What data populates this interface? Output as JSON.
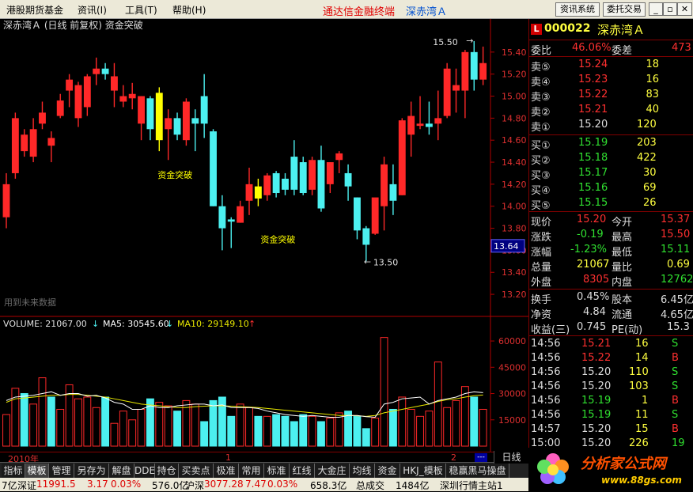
{
  "menu": {
    "items": [
      "港股期货基金",
      "资讯(I)",
      "工具(T)",
      "帮助(H)"
    ],
    "promo": "通达信金融终端",
    "stock_title": "深赤湾Ａ",
    "btn_news": "资讯系统",
    "btn_trade": "委托交易"
  },
  "chart": {
    "header": "深赤湾Ａ (日线 前复权) 资金突破",
    "ylim": [
      13.1,
      15.6
    ],
    "yticks": [
      "15.40",
      "15.20",
      "15.00",
      "14.80",
      "14.60",
      "14.40",
      "14.20",
      "14.00",
      "13.80",
      "13.60",
      "13.40",
      "13.20"
    ],
    "ytick_values": [
      15.4,
      15.2,
      15.0,
      14.8,
      14.6,
      14.4,
      14.2,
      14.0,
      13.8,
      13.6,
      13.4,
      13.2
    ],
    "current_price_tag": "13.64",
    "annotation_high": "15.50",
    "annotation_low": "13.50",
    "signal_label": "资金突破",
    "watermark": "用到未来数据",
    "colors": {
      "up": "#ff2828",
      "down": "#4cf0f0",
      "signal": "#ffff00",
      "ma5": "#ffffff",
      "ma10": "#e8e800",
      "axis": "#b00000"
    }
  },
  "chart_data": [
    {
      "type": "candlestick",
      "title": "深赤湾Ａ (日线 前复权) 资金突破",
      "candles": [
        {
          "o": 13.9,
          "h": 14.3,
          "l": 13.8,
          "c": 14.2
        },
        {
          "o": 14.3,
          "h": 14.85,
          "l": 14.25,
          "c": 14.8
        },
        {
          "o": 14.5,
          "h": 14.7,
          "l": 14.45,
          "c": 14.65
        },
        {
          "o": 14.45,
          "h": 14.8,
          "l": 14.4,
          "c": 14.7
        },
        {
          "o": 14.75,
          "h": 14.95,
          "l": 14.7,
          "c": 14.85
        },
        {
          "o": 14.55,
          "h": 14.68,
          "l": 14.4,
          "c": 14.62
        },
        {
          "o": 14.82,
          "h": 15.02,
          "l": 14.8,
          "c": 14.96
        },
        {
          "o": 15.05,
          "h": 15.2,
          "l": 14.9,
          "c": 15.15
        },
        {
          "o": 14.8,
          "h": 15.13,
          "l": 14.72,
          "c": 15.1
        },
        {
          "o": 14.9,
          "h": 15.2,
          "l": 14.82,
          "c": 15.18
        },
        {
          "o": 15.2,
          "h": 15.35,
          "l": 15.1,
          "c": 15.25
        },
        {
          "o": 15.25,
          "h": 15.3,
          "l": 15.15,
          "c": 15.2
        },
        {
          "o": 15.05,
          "h": 15.3,
          "l": 14.9,
          "c": 15.18
        },
        {
          "o": 14.95,
          "h": 15.1,
          "l": 14.9,
          "c": 15.0
        },
        {
          "o": 14.98,
          "h": 15.12,
          "l": 14.88,
          "c": 15.02
        },
        {
          "o": 14.75,
          "h": 15.0,
          "l": 14.6,
          "c": 15.0
        },
        {
          "o": 14.98,
          "h": 15.0,
          "l": 14.6,
          "c": 14.7
        },
        {
          "o": 14.6,
          "h": 15.08,
          "l": 14.5,
          "c": 15.03
        },
        {
          "o": 14.7,
          "h": 14.88,
          "l": 14.42,
          "c": 14.8
        },
        {
          "o": 14.8,
          "h": 14.85,
          "l": 14.6,
          "c": 14.65
        },
        {
          "o": 14.6,
          "h": 14.98,
          "l": 14.55,
          "c": 14.95
        },
        {
          "o": 14.8,
          "h": 14.88,
          "l": 14.5,
          "c": 14.75
        },
        {
          "o": 15.0,
          "h": 15.2,
          "l": 14.62,
          "c": 14.75
        },
        {
          "o": 14.68,
          "h": 14.7,
          "l": 14.0,
          "c": 14.0
        },
        {
          "o": 14.0,
          "h": 14.1,
          "l": 13.6,
          "c": 13.8
        },
        {
          "o": 13.88,
          "h": 13.9,
          "l": 13.62,
          "c": 13.86
        },
        {
          "o": 13.85,
          "h": 14.05,
          "l": 13.85,
          "c": 14.0
        },
        {
          "o": 14.05,
          "h": 14.35,
          "l": 13.92,
          "c": 14.2
        },
        {
          "o": 14.18,
          "h": 14.25,
          "l": 14.0,
          "c": 14.07
        },
        {
          "o": 14.1,
          "h": 14.3,
          "l": 14.05,
          "c": 14.28
        },
        {
          "o": 14.3,
          "h": 14.32,
          "l": 14.08,
          "c": 14.12
        },
        {
          "o": 14.25,
          "h": 14.3,
          "l": 14.1,
          "c": 14.15
        },
        {
          "o": 14.45,
          "h": 14.6,
          "l": 14.1,
          "c": 14.15
        },
        {
          "o": 14.4,
          "h": 14.45,
          "l": 14.1,
          "c": 14.12
        },
        {
          "o": 14.15,
          "h": 14.45,
          "l": 14.1,
          "c": 14.42
        },
        {
          "o": 14.42,
          "h": 14.55,
          "l": 13.95,
          "c": 13.98
        },
        {
          "o": 14.2,
          "h": 14.4,
          "l": 14.12,
          "c": 14.4
        },
        {
          "o": 14.42,
          "h": 14.5,
          "l": 14.3,
          "c": 14.48
        },
        {
          "o": 14.3,
          "h": 14.38,
          "l": 14.05,
          "c": 14.18
        },
        {
          "o": 14.08,
          "h": 14.08,
          "l": 13.7,
          "c": 13.78
        },
        {
          "o": 13.8,
          "h": 13.82,
          "l": 13.5,
          "c": 13.65
        },
        {
          "o": 13.75,
          "h": 14.02,
          "l": 13.74,
          "c": 14.08
        },
        {
          "o": 14.0,
          "h": 14.45,
          "l": 13.78,
          "c": 14.38
        },
        {
          "o": 14.2,
          "h": 14.38,
          "l": 13.92,
          "c": 14.05
        },
        {
          "o": 14.1,
          "h": 14.8,
          "l": 14.1,
          "c": 14.78
        },
        {
          "o": 14.65,
          "h": 14.95,
          "l": 14.45,
          "c": 14.82
        },
        {
          "o": 14.73,
          "h": 15.0,
          "l": 14.7,
          "c": 14.75
        },
        {
          "o": 14.75,
          "h": 14.95,
          "l": 14.65,
          "c": 14.72
        },
        {
          "o": 14.75,
          "h": 15.05,
          "l": 14.6,
          "c": 14.8
        },
        {
          "o": 14.82,
          "h": 15.3,
          "l": 14.8,
          "c": 15.25
        },
        {
          "o": 15.05,
          "h": 15.25,
          "l": 14.85,
          "c": 15.1
        },
        {
          "o": 15.05,
          "h": 15.42,
          "l": 14.8,
          "c": 15.4
        },
        {
          "o": 15.4,
          "h": 15.5,
          "l": 15.05,
          "c": 15.15
        },
        {
          "o": 15.15,
          "h": 15.45,
          "l": 15.1,
          "c": 15.3
        }
      ],
      "signals": [
        17,
        28
      ],
      "x_labels": [
        "2010年",
        "1",
        "2"
      ]
    },
    {
      "type": "bar",
      "title": "VOLUME",
      "legend": [
        "VOLUME: 21067.00",
        "MA5: 30545.60",
        "MA10: 29149.10"
      ],
      "values": [
        18000,
        33000,
        30000,
        24000,
        39000,
        28000,
        21000,
        35000,
        27000,
        28000,
        22000,
        28000,
        13000,
        20000,
        15000,
        21000,
        27000,
        25000,
        23000,
        20000,
        26000,
        24000,
        14000,
        26000,
        28000,
        17000,
        24000,
        22000,
        17000,
        17000,
        18000,
        17000,
        14000,
        18000,
        17000,
        14000,
        16000,
        19000,
        20000,
        17000,
        10000,
        16000,
        62000,
        21000,
        28000,
        21000,
        17000,
        20000,
        48000,
        22000,
        26000,
        34000,
        28000,
        21000
      ],
      "up": [
        true,
        true,
        false,
        true,
        true,
        false,
        true,
        true,
        true,
        true,
        true,
        false,
        true,
        true,
        true,
        true,
        false,
        true,
        true,
        false,
        true,
        true,
        false,
        false,
        false,
        false,
        true,
        true,
        false,
        true,
        false,
        false,
        false,
        false,
        true,
        false,
        true,
        true,
        false,
        false,
        false,
        true,
        true,
        false,
        true,
        true,
        true,
        true,
        true,
        true,
        true,
        true,
        false,
        true
      ],
      "ma5": [
        26000,
        28000,
        28500,
        29000,
        30000,
        31000,
        29000,
        30000,
        30000,
        28500,
        29000,
        27500,
        25000,
        24000,
        21000,
        21000,
        23000,
        22000,
        22000,
        23000,
        23500,
        24000,
        24000,
        23000,
        23500,
        22000,
        22000,
        22000,
        21500,
        20000,
        19000,
        18000,
        17500,
        17000,
        17500,
        17000,
        16500,
        16500,
        17500,
        17500,
        16800,
        16500,
        24000,
        25000,
        27000,
        27500,
        28000,
        24000,
        26000,
        27000,
        28000,
        30000,
        31000,
        30500
      ],
      "ma10": [
        25000,
        27000,
        27500,
        28000,
        28500,
        29000,
        29000,
        29500,
        29500,
        29000,
        28500,
        28000,
        27000,
        26000,
        25000,
        24000,
        23500,
        23000,
        22500,
        22000,
        22000,
        22500,
        22800,
        23000,
        23000,
        22800,
        22500,
        22300,
        22000,
        21500,
        21000,
        20500,
        20000,
        19500,
        19000,
        18500,
        18000,
        17500,
        17500,
        17300,
        17000,
        17500,
        19000,
        20000,
        21000,
        22000,
        23000,
        24000,
        25500,
        26500,
        27000,
        28000,
        28800,
        29149
      ],
      "ylim": [
        0,
        65000
      ],
      "yticks": [
        "60000",
        "45000",
        "30000",
        "15000"
      ],
      "ytick_values": [
        60000,
        45000,
        30000,
        15000
      ]
    }
  ],
  "quote": {
    "code": "000022",
    "name": "深赤湾Ａ",
    "wb_label": "委比",
    "wb": "46.06%",
    "wc_label": "委差",
    "wc": "473",
    "asks": [
      {
        "label": "卖⑤",
        "price": "15.24",
        "vol": "18"
      },
      {
        "label": "卖④",
        "price": "15.23",
        "vol": "16"
      },
      {
        "label": "卖③",
        "price": "15.22",
        "vol": "83"
      },
      {
        "label": "卖②",
        "price": "15.21",
        "vol": "40"
      },
      {
        "label": "卖①",
        "price": "15.20",
        "vol": "120"
      }
    ],
    "bids": [
      {
        "label": "买①",
        "price": "15.19",
        "vol": "203"
      },
      {
        "label": "买②",
        "price": "15.18",
        "vol": "422"
      },
      {
        "label": "买③",
        "price": "15.17",
        "vol": "30"
      },
      {
        "label": "买④",
        "price": "15.16",
        "vol": "69"
      },
      {
        "label": "买⑤",
        "price": "15.15",
        "vol": "26"
      }
    ],
    "stats": [
      {
        "l1": "现价",
        "v1": "15.20",
        "l2": "今开",
        "v2": "15.37"
      },
      {
        "l1": "涨跌",
        "v1": "-0.19",
        "l2": "最高",
        "v2": "15.50"
      },
      {
        "l1": "涨幅",
        "v1": "-1.23%",
        "l2": "最低",
        "v2": "15.11"
      },
      {
        "l1": "总量",
        "v1": "21067",
        "l2": "量比",
        "v2": "0.69"
      },
      {
        "l1": "外盘",
        "v1": "8305",
        "l2": "内盘",
        "v2": "12762"
      }
    ],
    "stats2": [
      {
        "l1": "换手",
        "v1": "0.45%",
        "l2": "股本",
        "v2": "6.45亿"
      },
      {
        "l1": "净资",
        "v1": "4.84",
        "l2": "流通",
        "v2": "4.65亿"
      },
      {
        "l1": "收益(三)",
        "v1": "0.745",
        "l2": "PE(动)",
        "v2": "15.3"
      }
    ],
    "ticks": [
      {
        "t": "14:56",
        "p": "15.21",
        "v": "16",
        "s": "S"
      },
      {
        "t": "14:56",
        "p": "15.22",
        "v": "14",
        "s": "B"
      },
      {
        "t": "14:56",
        "p": "15.20",
        "v": "110",
        "s": "S"
      },
      {
        "t": "14:56",
        "p": "15.20",
        "v": "103",
        "s": "S"
      },
      {
        "t": "14:56",
        "p": "15.19",
        "v": "1",
        "s": "B"
      },
      {
        "t": "14:56",
        "p": "15.19",
        "v": "11",
        "s": "S"
      },
      {
        "t": "14:57",
        "p": "15.20",
        "v": "15",
        "s": "B"
      },
      {
        "t": "15:00",
        "p": "15.20",
        "v": "226",
        "s": "19"
      }
    ]
  },
  "tabs": [
    "指标",
    "模板",
    "管理",
    "另存为",
    "解盘",
    "DDE",
    "持仓",
    "买卖点",
    "极准",
    "常用",
    "标准",
    "红线",
    "大金庄",
    "均线",
    "资金",
    "HKJ_模板",
    "稳赢黑马操盘"
  ],
  "period": "日线",
  "ticker": [
    {
      "text": "深证",
      "c": "#000"
    },
    {
      "text": "11991.5",
      "c": "#d00"
    },
    {
      "text": "3.17",
      "c": "#d00"
    },
    {
      "text": "0.03%",
      "c": "#d00"
    },
    {
      "text": "576.0亿",
      "c": "#000"
    },
    {
      "text": "沪深",
      "c": "#000"
    },
    {
      "text": "3077.28",
      "c": "#d00"
    },
    {
      "text": "7.47",
      "c": "#d00"
    },
    {
      "text": "0.03%",
      "c": "#d00"
    },
    {
      "text": "658.3亿",
      "c": "#000"
    },
    {
      "text": "总成交",
      "c": "#000"
    },
    {
      "text": "1484亿",
      "c": "#000"
    },
    {
      "text": "深圳行情主站1",
      "c": "#000"
    }
  ],
  "ticker_prefix": "7亿",
  "logo": {
    "name": "分析家公式网",
    "url": "www.88gs.com"
  }
}
